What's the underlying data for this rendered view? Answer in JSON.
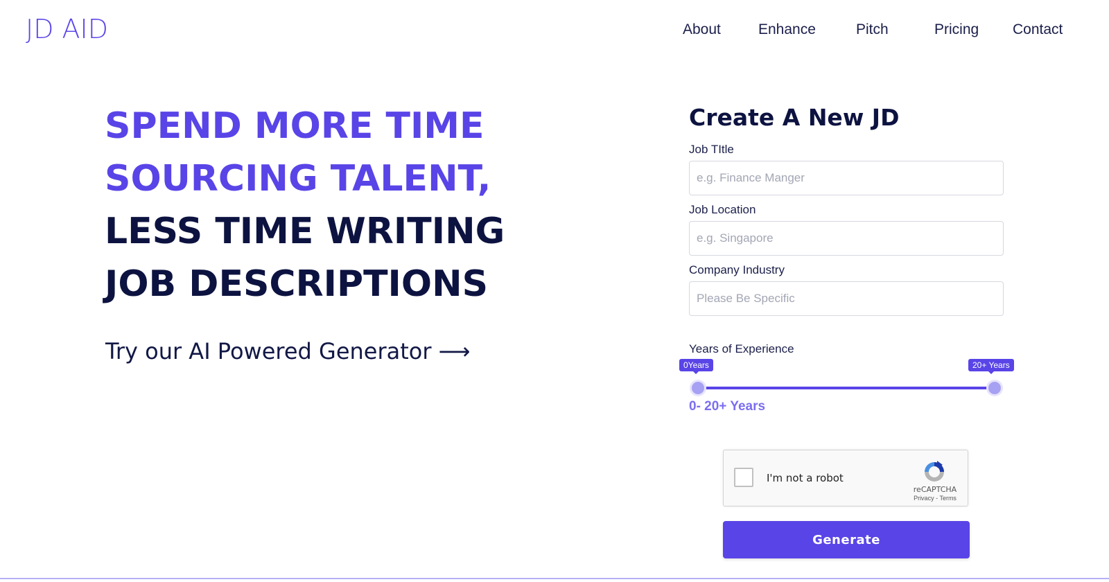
{
  "header": {
    "logo": "JD AID",
    "nav": [
      {
        "label": "About"
      },
      {
        "label": "Enhance"
      },
      {
        "label": "Pitch"
      },
      {
        "label": "Pricing"
      },
      {
        "label": "Contact"
      }
    ]
  },
  "hero": {
    "lines": [
      "SPEND MORE TIME",
      "SOURCING TALENT,",
      "LESS TIME WRITING",
      "JOB DESCRIPTIONS"
    ],
    "cta": "Try our AI Powered Generator",
    "cta_arrow": "⟶"
  },
  "form": {
    "title": "Create A New JD",
    "job_title": {
      "label": "Job TItle",
      "placeholder": "e.g. Finance Manger"
    },
    "job_location": {
      "label": "Job Location",
      "placeholder": "e.g. Singapore"
    },
    "company_industry": {
      "label": "Company Industry",
      "placeholder": "Please Be Specific"
    },
    "experience": {
      "label": "Years of Experience",
      "min_tooltip": "0Years",
      "max_tooltip": "20+ Years",
      "range_text": "0- 20+ Years",
      "min_value": 0,
      "max_value": 20
    },
    "captcha": {
      "label": "I'm not a robot",
      "brand": "reCAPTCHA",
      "privacy": "Privacy",
      "separator": "-",
      "terms": "Terms"
    },
    "generate_label": "Generate"
  },
  "colors": {
    "accent": "#5944e7",
    "dark_text": "#0d1340",
    "slider_thumb": "#a7a1f3"
  }
}
